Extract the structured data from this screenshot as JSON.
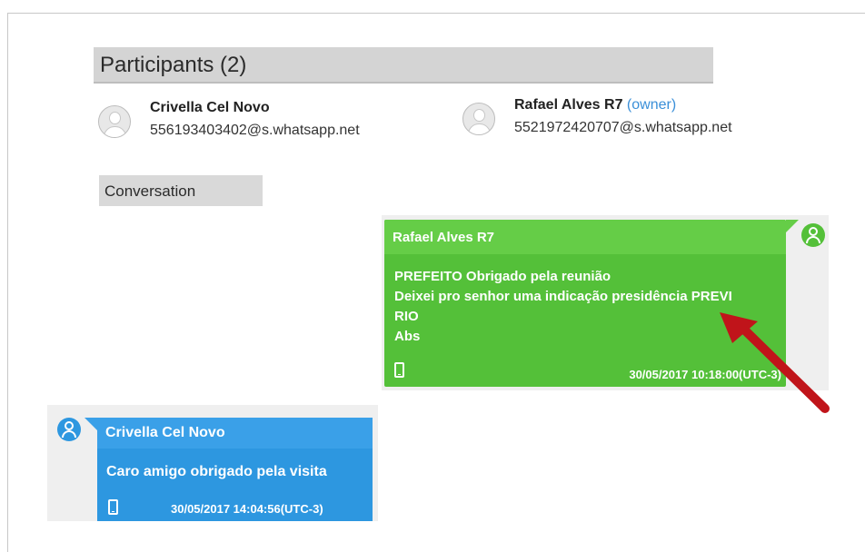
{
  "participants_section": {
    "title": "Participants (2)",
    "participants": [
      {
        "name": "Crivella Cel Novo",
        "role": "",
        "jid": "556193403402@s.whatsapp.net"
      },
      {
        "name": "Rafael Alves R7",
        "role": "(owner)",
        "jid": "5521972420707@s.whatsapp.net"
      }
    ]
  },
  "conversation": {
    "title": "Conversation",
    "messages": [
      {
        "direction": "outgoing",
        "sender": "Rafael Alves R7",
        "lines": [
          "PREFEITO Obrigado pela reunião",
          "Deixei pro senhor uma indicação presidência PREVI",
          "RIO",
          "Abs"
        ],
        "device_icon": "phone-icon",
        "timestamp": "30/05/2017 10:18:00(UTC-3)",
        "bubble_color": "#54c039"
      },
      {
        "direction": "incoming",
        "sender": "Crivella Cel Novo",
        "text": "Caro amigo obrigado pela visita",
        "device_icon": "phone-icon",
        "timestamp": "30/05/2017 14:04:56(UTC-3)",
        "bubble_color": "#2d97e0"
      }
    ]
  },
  "annotation": {
    "type": "red-arrow",
    "color": "#c0141a"
  }
}
